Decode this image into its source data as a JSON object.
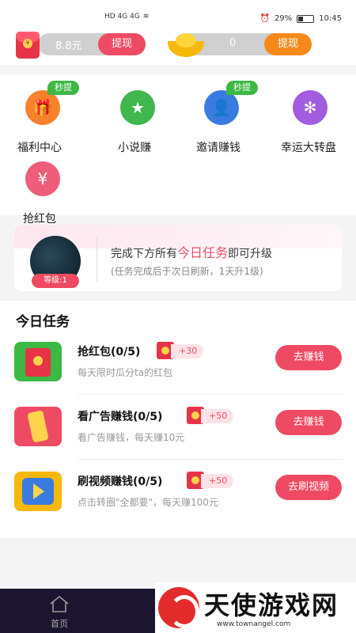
{
  "status_bar": {
    "left_text": "HD 4G 4G",
    "battery": "29%",
    "time": "10:45"
  },
  "balance": {
    "cash_value": "8.8元",
    "cash_withdraw_label": "提现",
    "coin_value": "0",
    "coin_withdraw_label": "提现"
  },
  "features": [
    {
      "label": "福利中心",
      "badge": "秒提现",
      "color": "#f7822a",
      "icon": "gift-icon"
    },
    {
      "label": "小说赚",
      "badge": "",
      "color": "#3fb64e",
      "icon": "book-star-icon"
    },
    {
      "label": "邀请赚钱",
      "badge": "秒提现",
      "color": "#3a7be0",
      "icon": "invite-user-icon"
    },
    {
      "label": "幸运大转盘",
      "badge": "",
      "color": "#a25ce0",
      "icon": "wheel-icon"
    },
    {
      "label": "抢红包",
      "badge": "",
      "color": "#ef5d7a",
      "icon": "red-envelope-icon"
    }
  ],
  "level_card": {
    "badge": "等级:1",
    "main_prefix": "完成下方所有",
    "main_highlight": "今日任务",
    "main_suffix": "即可升级",
    "sub": "(任务完成后于次日刷新，1天升1级)"
  },
  "tasks_section": {
    "title": "今日任务",
    "items": [
      {
        "name": "抢红包(0/5)",
        "reward": "+30",
        "desc": "每天限时瓜分ta的红包",
        "button": "去赚钱",
        "icon": "red-envelope-icon",
        "icon_color": "#3cb844"
      },
      {
        "name": "看广告赚钱(0/5)",
        "reward": "+50",
        "desc": "看广告赚钱，每天赚10元",
        "button": "去赚钱",
        "icon": "phone-ad-icon",
        "icon_color": "#ef4a63"
      },
      {
        "name": "刷视频赚钱(0/5)",
        "reward": "+50",
        "desc": "点击转圈\"全都要\"，每天赚100元",
        "button": "去刷视频",
        "icon": "video-play-icon",
        "icon_color": "#f6b80b"
      }
    ]
  },
  "bottom_nav": {
    "home_label": "首页"
  },
  "watermark": {
    "title": "天使游戏网",
    "url": "www.townangel.com"
  },
  "colors": {
    "accent": "#ef4a63",
    "orange": "#f7891b",
    "green_badge": "#3cb844",
    "nav_bg": "#1b1530"
  }
}
